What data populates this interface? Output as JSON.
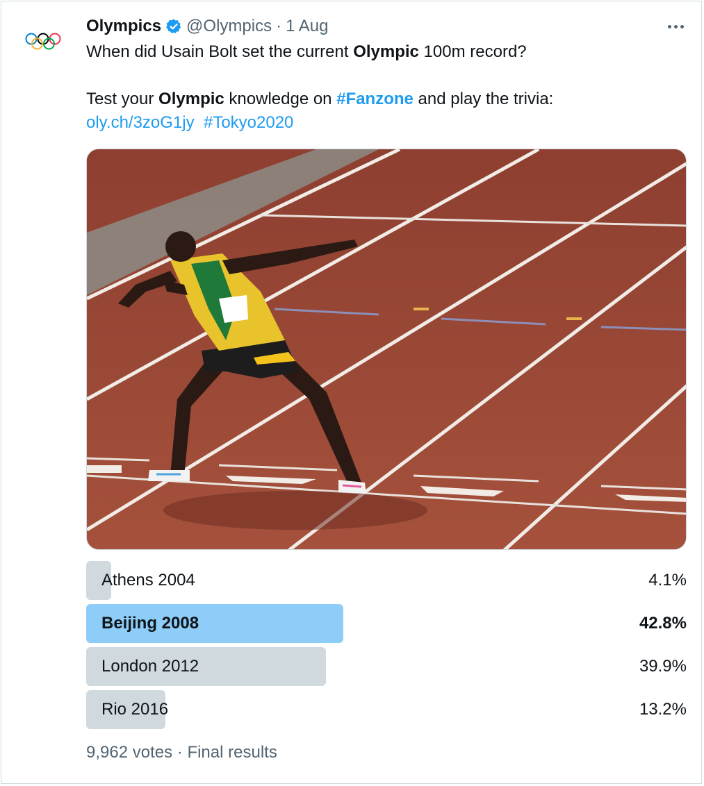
{
  "author": {
    "name": "Olympics",
    "handle": "@Olympics",
    "separator": "·",
    "date": "1 Aug",
    "avatar_icon": "olympic-rings-icon",
    "verified_icon": "verified-badge-icon"
  },
  "tweet": {
    "line1_pre": "When did Usain Bolt set the current ",
    "line1_bold": "Olympic",
    "line1_post": " 100m record?",
    "line2_pre": "Test your ",
    "line2_bold": "Olympic",
    "line2_mid": " knowledge on ",
    "line2_hashtag": "#Fanzone",
    "line2_post": " and play the trivia:",
    "link": "oly.ch/3zoG1jy",
    "hashtag": "#Tokyo2020"
  },
  "media": {
    "description_icon": "photo-usain-bolt-lightning-pose"
  },
  "poll": {
    "options": [
      {
        "label": "Athens 2004",
        "percent": "4.1%",
        "value": 4.1,
        "winner": false
      },
      {
        "label": "Beijing 2008",
        "percent": "42.8%",
        "value": 42.8,
        "winner": true
      },
      {
        "label": "London 2012",
        "percent": "39.9%",
        "value": 39.9,
        "winner": false
      },
      {
        "label": "Rio 2016",
        "percent": "13.2%",
        "value": 13.2,
        "winner": false
      }
    ],
    "votes": "9,962 votes",
    "separator": "·",
    "status": "Final results"
  },
  "colors": {
    "link": "#1d9bf0",
    "winner_bar": "#8ecdf8",
    "bar": "#cfd9de",
    "secondary_text": "#536471"
  }
}
